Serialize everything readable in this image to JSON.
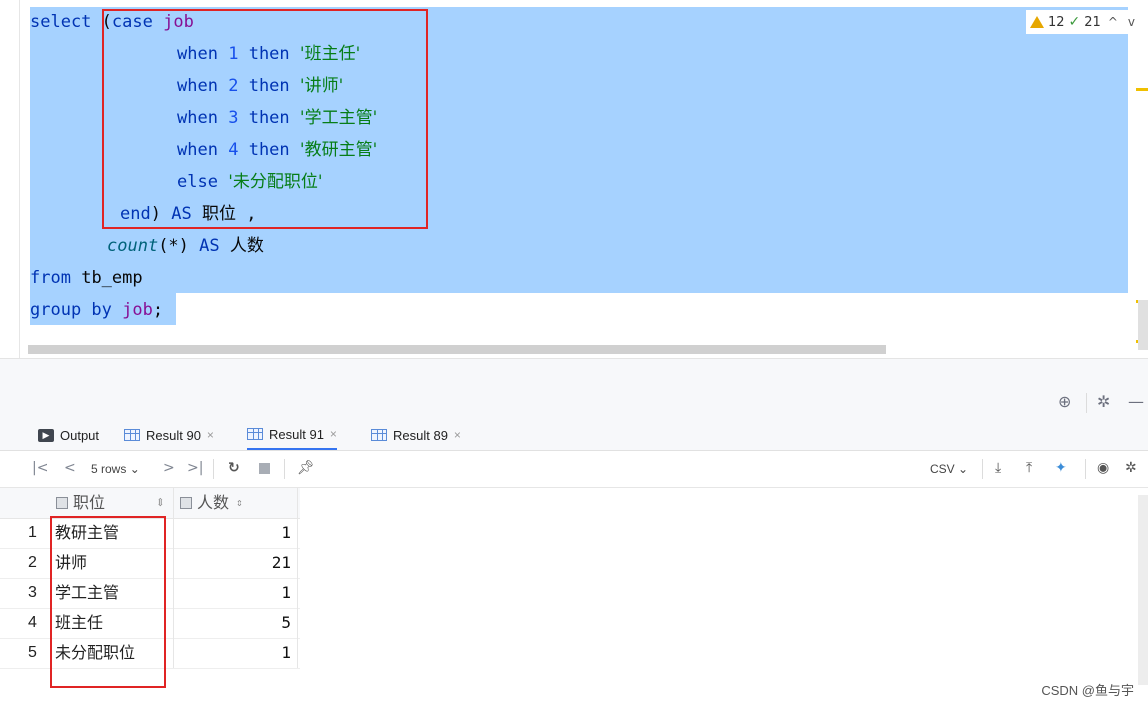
{
  "editor": {
    "lines": [
      {
        "id": "l1"
      },
      {
        "id": "l2"
      }
    ],
    "code": {
      "l1_select": "select",
      "l1_paren": " (",
      "l1_case": "case",
      "l1_sp": " ",
      "l1_job": "job",
      "when": "when",
      "then": "then",
      "w1_num": "1",
      "w1_str": "'班主任'",
      "w2_num": "2",
      "w2_str": "'讲师'",
      "w3_num": "3",
      "w3_str": "'学工主管'",
      "w4_num": "4",
      "w4_str": "'教研主管'",
      "else": "else",
      "else_str": "'未分配职位'",
      "end": "end",
      "end_paren": ")",
      "as": "AS",
      "alias1": "职位",
      "comma": " ,",
      "count_fn": "count",
      "count_args": "(*)",
      "alias2": "人数",
      "from": "from",
      "table": "tb_emp",
      "group_by": "group by",
      "group_col": "job",
      "semicolon": ";"
    }
  },
  "inspection": {
    "warnings": "12",
    "ok": "21",
    "up": "^",
    "down": "v"
  },
  "tabs": [
    {
      "label": "Output"
    },
    {
      "label": "Result 90"
    },
    {
      "label": "Result 91"
    },
    {
      "label": "Result 89"
    }
  ],
  "tab_close": "×",
  "toolbar": {
    "rows": "5 rows",
    "export": "CSV"
  },
  "grid": {
    "columns": [
      "职位",
      "人数"
    ],
    "rows": [
      {
        "n": "1",
        "job": "教研主管",
        "count": "1"
      },
      {
        "n": "2",
        "job": "讲师",
        "count": "21"
      },
      {
        "n": "3",
        "job": "学工主管",
        "count": "1"
      },
      {
        "n": "4",
        "job": "班主任",
        "count": "5"
      },
      {
        "n": "5",
        "job": "未分配职位",
        "count": "1"
      }
    ]
  },
  "watermark": "CSDN @鱼与宇",
  "colors": {
    "selection": "#a6d2ff",
    "keyword": "#0033b3",
    "string": "#067d17",
    "number": "#1750eb",
    "highlight_box": "#e02424",
    "active_tab": "#3574f0"
  }
}
